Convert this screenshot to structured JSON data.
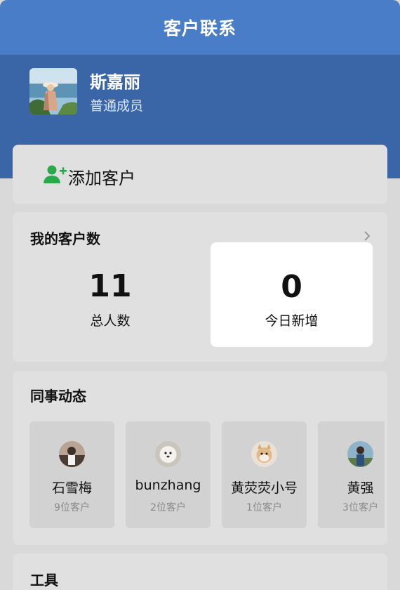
{
  "window": {
    "title": "客户联系"
  },
  "user": {
    "name": "斯嘉丽",
    "role": "普通成员"
  },
  "add_customer": {
    "label": "添加客户",
    "icon": "add-user-icon",
    "icon_color": "#2aa84a"
  },
  "my_customers": {
    "title": "我的客户数",
    "total": {
      "value": "11",
      "label": "总人数"
    },
    "today": {
      "value": "0",
      "label": "今日新增"
    }
  },
  "colleagues": {
    "title": "同事动态",
    "items": [
      {
        "name": "石雪梅",
        "count": "9位客户"
      },
      {
        "name": "bunzhang",
        "count": "2位客户"
      },
      {
        "name": "黄荧荧小号",
        "count": "1位客户"
      },
      {
        "name": "黄强",
        "count": "3位客户"
      }
    ]
  },
  "tools": {
    "title": "工具"
  },
  "colors": {
    "title_bar": "#4a7dc7",
    "header_band": "#3a66a8",
    "background": "#d9d9d9"
  }
}
